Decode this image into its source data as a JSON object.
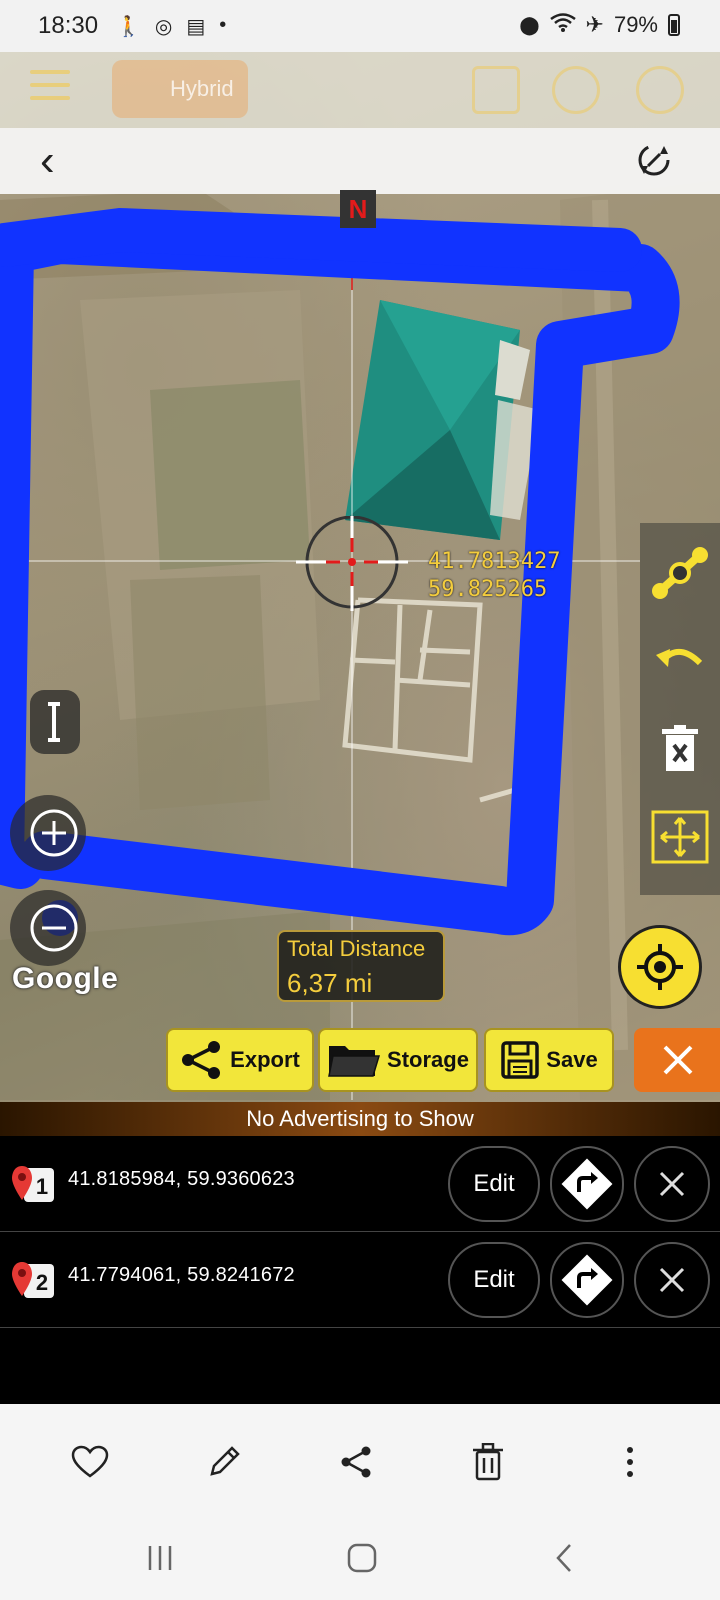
{
  "status_bar": {
    "time": "18:30",
    "battery_percent": "79%",
    "dot": "•"
  },
  "app_bar": {
    "map_type_label": "Hybrid"
  },
  "map": {
    "north_label": "N",
    "crosshair_lat": "41.7813427",
    "crosshair_lon": "59.825265",
    "provider_logo": "Google",
    "track_color": "#1133ff",
    "crosshair_color": "#e31b1b"
  },
  "distance": {
    "title": "Total Distance",
    "value": "6,37 mi"
  },
  "actions": {
    "export_label": "Export",
    "storage_label": "Storage",
    "save_label": "Save"
  },
  "banner": {
    "text": "No Advertising to Show"
  },
  "waypoints": [
    {
      "index": "1",
      "coords": "41.8185984,   59.9360623",
      "edit_label": "Edit"
    },
    {
      "index": "2",
      "coords": "41.7794061,   59.8241672",
      "edit_label": "Edit"
    }
  ],
  "icons": {
    "status": [
      "walking-icon",
      "chrome-icon",
      "calendar-icon",
      "location-icon",
      "wifi-icon",
      "airplane-icon",
      "battery-icon"
    ],
    "bottom_toolbar": [
      "heart-icon",
      "pencil-icon",
      "share-icon",
      "trash-icon",
      "more-vertical-icon"
    ],
    "system_nav": [
      "recents-icon",
      "home-icon",
      "back-icon"
    ]
  },
  "colors": {
    "accent_yellow": "#f2e63a",
    "close_orange": "#e9731c",
    "distance_text": "#f4cd3d"
  }
}
